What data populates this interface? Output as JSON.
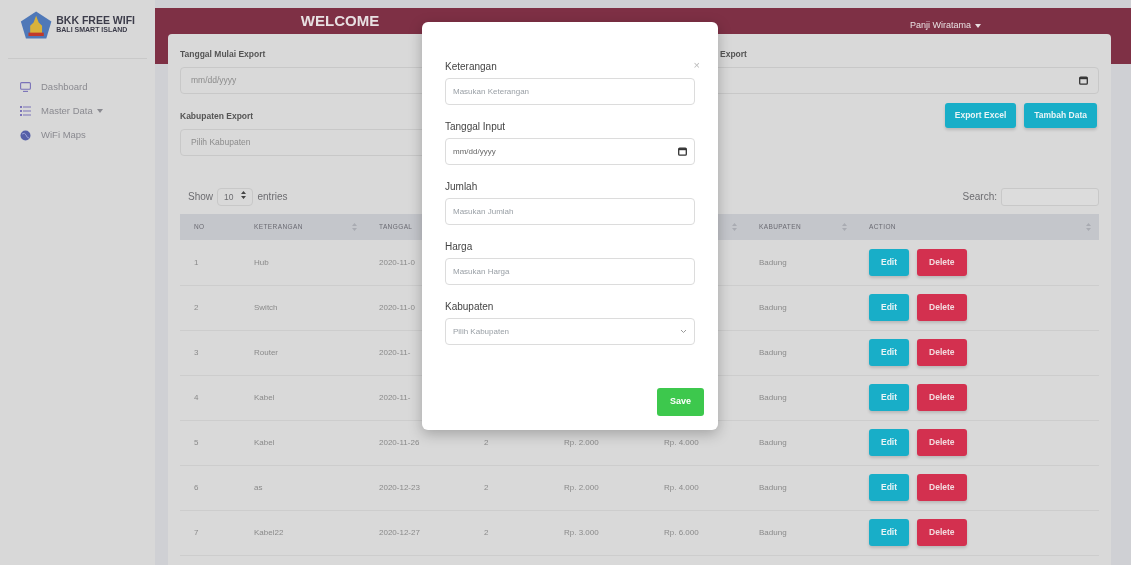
{
  "sidebar": {
    "brand_title": "BKK FREE WIFI",
    "brand_subtitle": "BALI SMART ISLAND",
    "items": [
      {
        "label": "Dashboard",
        "kind": "monitor",
        "dropdown": false
      },
      {
        "label": "Master Data",
        "kind": "list",
        "dropdown": true
      },
      {
        "label": "WiFi Maps",
        "kind": "globe",
        "dropdown": false
      }
    ]
  },
  "header": {
    "title": "WELCOME",
    "user": "Panji Wiratama"
  },
  "filters": {
    "start_label": "Tanggal Mulai Export",
    "start_placeholder": "mm/dd/yyyy",
    "end_label": "Export",
    "kabupaten_label": "Kabupaten Export",
    "kabupaten_placeholder": "Pilih Kabupaten"
  },
  "actions": [
    "Export Excel",
    "Tambah Data"
  ],
  "table": {
    "show_label": "Show",
    "length_value": "10",
    "entries_label": "entries",
    "search_label": "Search:",
    "columns": [
      {
        "label": "NO",
        "sortable": false
      },
      {
        "label": "KETERANGAN",
        "sortable": true
      },
      {
        "label": "TANGGAL"
      },
      {},
      {},
      {
        "sortable": true
      },
      {
        "label": "KABUPATEN",
        "sortable": true
      },
      {
        "label": "ACTION",
        "sortable": true
      }
    ],
    "rows": [
      {
        "no": "1",
        "keterangan": "Hub",
        "tanggal": "2020-11-0",
        "kabupaten": "Badung",
        "actions": [
          "Edit",
          "Delete"
        ]
      },
      {
        "no": "2",
        "keterangan": "Switch",
        "tanggal": "2020-11-0",
        "kabupaten": "Badung",
        "actions": [
          "Edit",
          "Delete"
        ]
      },
      {
        "no": "3",
        "keterangan": "Router",
        "tanggal": "2020-11-",
        "kabupaten": "Badung",
        "actions": [
          "Edit",
          "Delete"
        ]
      },
      {
        "no": "4",
        "keterangan": "Kabel",
        "tanggal": "2020-11-",
        "kabupaten": "Badung",
        "actions": [
          "Edit",
          "Delete"
        ]
      },
      {
        "no": "5",
        "keterangan": "Kabel",
        "tanggal": "2020-11-26",
        "column_4": "2",
        "column_5": "Rp. 2.000",
        "column_6": "Rp. 4.000",
        "kabupaten": "Badung",
        "actions": [
          "Edit",
          "Delete"
        ]
      },
      {
        "no": "6",
        "keterangan": "as",
        "tanggal": "2020-12-23",
        "column_4": "2",
        "column_5": "Rp. 2.000",
        "column_6": "Rp. 4.000",
        "kabupaten": "Badung",
        "actions": [
          "Edit",
          "Delete"
        ]
      },
      {
        "no": "7",
        "keterangan": "Kabel22",
        "tanggal": "2020-12-27",
        "column_4": "2",
        "column_5": "Rp. 3.000",
        "column_6": "Rp. 6.000",
        "kabupaten": "Badung",
        "actions": [
          "Edit",
          "Delete"
        ]
      }
    ]
  },
  "modal": {
    "close": "×",
    "fields": [
      {
        "kind": "text",
        "label": "Keterangan",
        "placeholder": "Masukan Keterangan"
      },
      {
        "kind": "date",
        "label": "Tanggal Input",
        "placeholder": "mm/dd/yyyy"
      },
      {
        "kind": "text",
        "label": "Jumlah",
        "placeholder": "Masukan Jumlah"
      },
      {
        "kind": "text",
        "label": "Harga",
        "placeholder": "Masukan Harga"
      },
      {
        "kind": "select",
        "label": "Kabupaten",
        "placeholder": "Pilih Kabupaten"
      }
    ],
    "save": "Save"
  }
}
